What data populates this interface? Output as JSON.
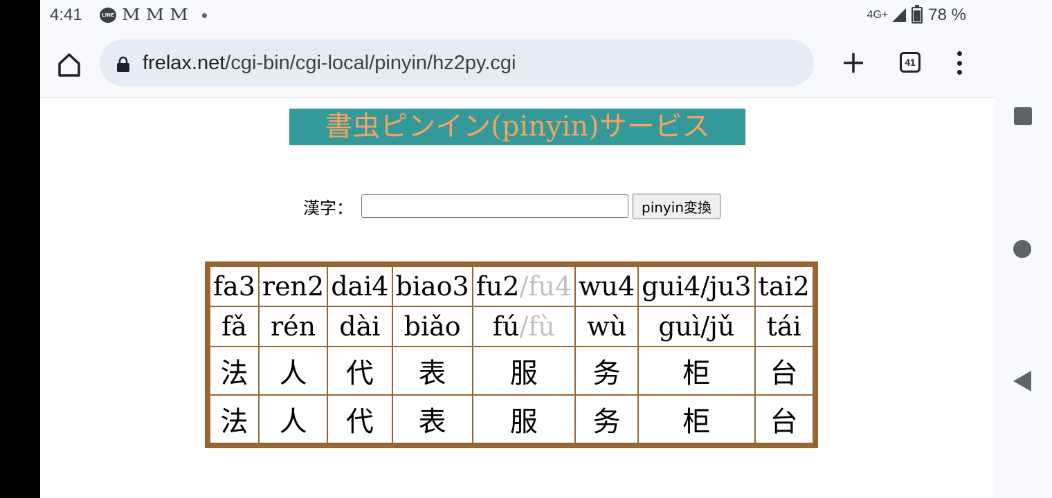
{
  "status_bar": {
    "time": "4:41",
    "network": "4G+",
    "battery": "78 %",
    "battery_level": 0.78,
    "notification_icons": [
      "line-icon",
      "mcdonalds-icon",
      "mcdonalds-icon",
      "mcdonalds-icon",
      "dot-icon"
    ],
    "line_label": "LINE",
    "m_glyph": "M"
  },
  "toolbar": {
    "url_host": "frelax.net",
    "url_path": "/cgi-bin/cgi-local/pinyin/hz2py.cgi",
    "tab_count": "41"
  },
  "page": {
    "banner_title": "書虫ピンイン(pinyin)サービス",
    "form": {
      "label": "漢字：",
      "input_value": "",
      "input_placeholder": "",
      "button_label": "pinyin変換"
    },
    "table": {
      "pinyin_numbered": [
        {
          "main": "fa3",
          "alt": ""
        },
        {
          "main": "ren2",
          "alt": ""
        },
        {
          "main": "dai4",
          "alt": ""
        },
        {
          "main": "biao3",
          "alt": ""
        },
        {
          "main": "fu2",
          "alt": "/fu4"
        },
        {
          "main": "wu4",
          "alt": ""
        },
        {
          "main": "gui4/ju3",
          "alt": ""
        },
        {
          "main": "tai2",
          "alt": ""
        }
      ],
      "pinyin_toned": [
        {
          "main": "fǎ",
          "alt": ""
        },
        {
          "main": "rén",
          "alt": ""
        },
        {
          "main": "dài",
          "alt": ""
        },
        {
          "main": "biǎo",
          "alt": ""
        },
        {
          "main": "fú",
          "alt": "/fù"
        },
        {
          "main": "wù",
          "alt": ""
        },
        {
          "main": "guì/jǔ",
          "alt": ""
        },
        {
          "main": "tái",
          "alt": ""
        }
      ],
      "hanzi_row_1": [
        "法",
        "人",
        "代",
        "表",
        "服",
        "务",
        "柜",
        "台"
      ],
      "hanzi_row_2": [
        "法",
        "人",
        "代",
        "表",
        "服",
        "务",
        "柜",
        "台"
      ]
    }
  },
  "colors": {
    "banner_bg": "#339999",
    "banner_text": "#f4a460",
    "table_border": "#996633",
    "alt_reading": "#c0c0c0"
  }
}
